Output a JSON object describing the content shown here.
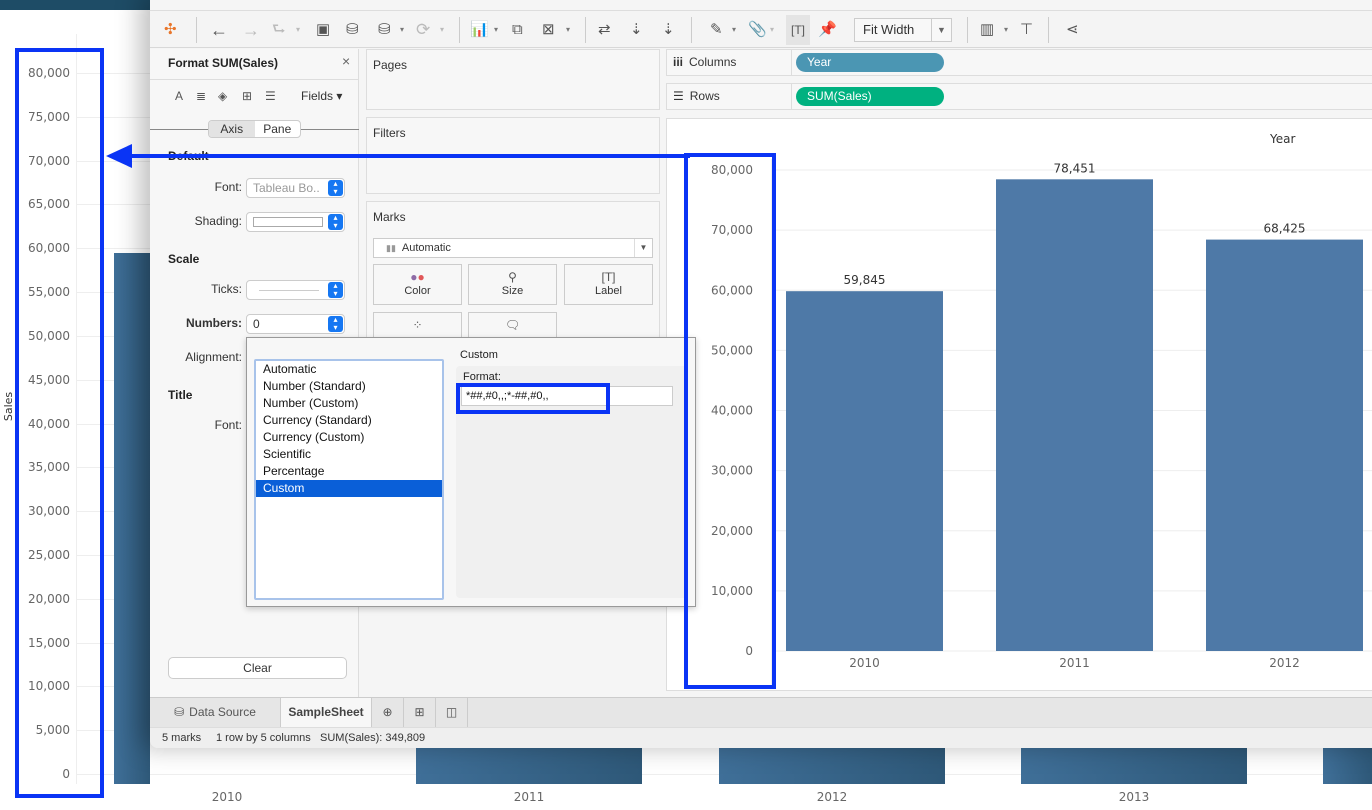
{
  "background_chart": {
    "y_axis_title": "Sales",
    "y_ticks": [
      "80,000",
      "75,000",
      "70,000",
      "65,000",
      "60,000",
      "55,000",
      "50,000",
      "45,000",
      "40,000",
      "35,000",
      "30,000",
      "25,000",
      "20,000",
      "15,000",
      "10,000",
      "5,000",
      "0"
    ],
    "x_labels": [
      "2010",
      "2011",
      "2012",
      "2013"
    ]
  },
  "toolbar": {
    "fit_width": "Fit Width",
    "icons": [
      "tableau-logo-icon",
      "back-icon",
      "forward-icon",
      "redo-icon",
      "save-icon",
      "new-datasource-icon",
      "pause-datasource-icon",
      "refresh-icon",
      "new-worksheet-icon",
      "duplicate-sheet-icon",
      "clear-sheet-icon",
      "swap-icon",
      "sort-ascending-icon",
      "sort-descending-icon",
      "highlight-icon",
      "annotate-icon",
      "show-labels-icon",
      "pin-icon",
      "show-me-icon",
      "presentation-icon",
      "share-icon"
    ]
  },
  "format_panel": {
    "title": "Format SUM(Sales)",
    "close": "×",
    "fields_label": "Fields ▾",
    "tabs": [
      "Axis",
      "Pane"
    ],
    "active_tab": "Axis",
    "sections": {
      "default": "Default",
      "scale": "Scale",
      "title": "Title"
    },
    "font_label": "Font:",
    "font_value": "Tableau Bo..",
    "shading_label": "Shading:",
    "ticks_label": "Ticks:",
    "numbers_label": "Numbers:",
    "numbers_value": "0",
    "alignment_label": "Alignment:",
    "title_font_label": "Font:",
    "clear_label": "Clear"
  },
  "number_format_popup": {
    "options": [
      "Automatic",
      "Number (Standard)",
      "Number (Custom)",
      "Currency (Standard)",
      "Currency (Custom)",
      "Scientific",
      "Percentage",
      "Custom"
    ],
    "selected": "Custom",
    "heading": "Custom",
    "format_label": "Format:",
    "format_value": "*##,#0,,;*-##,#0,,"
  },
  "cards": {
    "pages": "Pages",
    "filters": "Filters",
    "marks": "Marks",
    "mark_type": "Automatic",
    "mark_buttons": [
      "Color",
      "Size",
      "Label"
    ]
  },
  "shelves": {
    "columns_label": "Columns",
    "columns_pill": "Year",
    "columns_color": "#4b96b3",
    "rows_label": "Rows",
    "rows_pill": "SUM(Sales)",
    "rows_color": "#00b180"
  },
  "view": {
    "header": "Year"
  },
  "chart_data": {
    "type": "bar",
    "title": "Year",
    "xlabel": "",
    "ylabel": "Sales",
    "categories": [
      "2010",
      "2011",
      "2012"
    ],
    "values": [
      59845,
      78451,
      68425
    ],
    "data_labels": [
      "59,845",
      "78,451",
      "68,425"
    ],
    "y_ticks": [
      "80,000",
      "70,000",
      "60,000",
      "50,000",
      "40,000",
      "30,000",
      "20,000",
      "10,000",
      "0"
    ],
    "ylim": [
      0,
      80000
    ],
    "grid": true,
    "bar_color": "#4e79a7"
  },
  "sheet_tabs": {
    "data_source": "Data Source",
    "active_sheet": "SampleSheet"
  },
  "status_bar": {
    "marks": "5 marks",
    "dimensions": "1 row by 5 columns",
    "sum": "SUM(Sales): 349,809"
  },
  "annotation_color": "#0a34f5"
}
